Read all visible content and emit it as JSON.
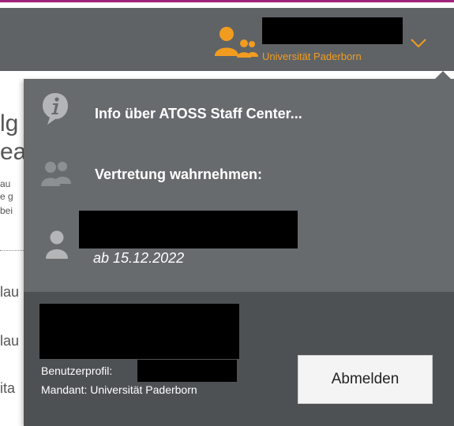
{
  "header": {
    "organization": "Universität Paderborn",
    "user_icon": "users-icon",
    "menu_toggle_icon": "chevron-down-icon",
    "background_color": "#5f6366",
    "accent_color": "#f29c1f"
  },
  "background_page": {
    "fragments": [
      "lg",
      "ea",
      "au",
      "e g",
      "bei",
      "lau",
      "lau",
      "ita"
    ]
  },
  "dropdown": {
    "info_label": "Info über ATOSS Staff Center...",
    "info_icon": "info-icon",
    "representation_label": "Vertretung wahrnehmen:",
    "representation_icon": "users-icon",
    "deputy": {
      "icon": "user-icon",
      "since": "ab 15.12.2022"
    },
    "footer": {
      "profile_label": "Benutzerprofil:",
      "mandant_label": "Mandant: Universität Paderborn",
      "logout_label": "Abmelden"
    },
    "panel_color": "#686b6e",
    "footer_color": "#4e5154"
  }
}
